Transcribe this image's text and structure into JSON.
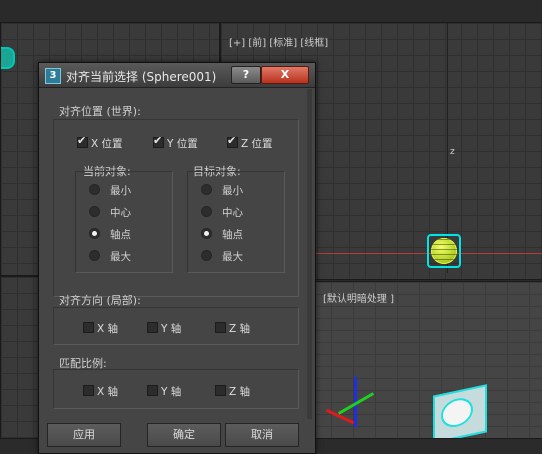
{
  "viewports": {
    "front_label": "[+] [前] [标准] [线框]",
    "persp_label": "[默认明暗处理 ]"
  },
  "axis_label_z": "z",
  "dialog": {
    "app_icon": "3",
    "title": "对齐当前选择 (Sphere001)",
    "help_label": "?",
    "close_label": "X",
    "align_position": {
      "title": "对齐位置 (世界):",
      "checks": [
        {
          "label": "X 位置",
          "checked": true
        },
        {
          "label": "Y 位置",
          "checked": true
        },
        {
          "label": "Z 位置",
          "checked": true
        }
      ],
      "current": {
        "title": "当前对象:",
        "options": [
          {
            "label": "最小",
            "selected": false
          },
          {
            "label": "中心",
            "selected": false
          },
          {
            "label": "轴点",
            "selected": true
          },
          {
            "label": "最大",
            "selected": false
          }
        ]
      },
      "target": {
        "title": "目标对象:",
        "options": [
          {
            "label": "最小",
            "selected": false
          },
          {
            "label": "中心",
            "selected": false
          },
          {
            "label": "轴点",
            "selected": true
          },
          {
            "label": "最大",
            "selected": false
          }
        ]
      }
    },
    "align_orientation": {
      "title": "对齐方向 (局部):",
      "checks": [
        {
          "label": "X 轴",
          "checked": false
        },
        {
          "label": "Y 轴",
          "checked": false
        },
        {
          "label": "Z 轴",
          "checked": false
        }
      ]
    },
    "match_scale": {
      "title": "匹配比例:",
      "checks": [
        {
          "label": "X 轴",
          "checked": false
        },
        {
          "label": "Y 轴",
          "checked": false
        },
        {
          "label": "Z 轴",
          "checked": false
        }
      ]
    },
    "buttons": {
      "apply": "应用",
      "ok": "确定",
      "cancel": "取消"
    }
  },
  "colors": {
    "selection": "#00e6e6",
    "sphere": "#d6ef3a",
    "close": "#c8412b"
  }
}
